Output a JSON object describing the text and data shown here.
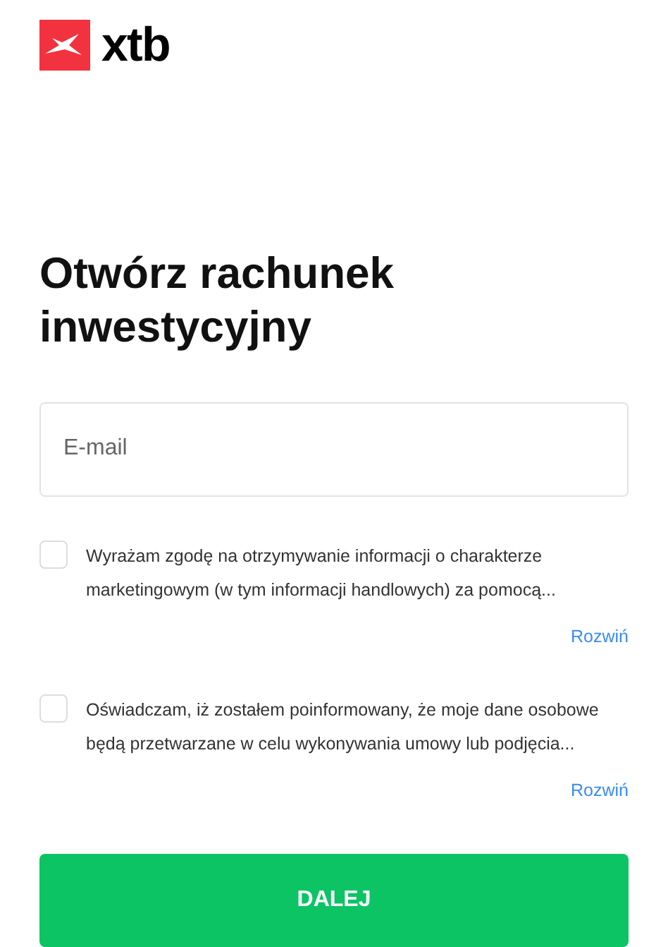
{
  "logo": {
    "text": "xtb"
  },
  "heading": "Otwórz rachunek inwestycyjny",
  "email": {
    "placeholder": "E-mail"
  },
  "consents": [
    {
      "text": "Wyrażam zgodę na otrzymywanie informacji o charakterze marketingowym (w tym informacji handlowych) za pomocą...",
      "checked": false,
      "expand_link": "Rozwiń"
    },
    {
      "text": "Oświadczam, iż zostałem poinformowany, że moje dane osobowe będą przetwarzane w celu wykonywania umowy lub podjęcia...",
      "checked": false,
      "expand_link": "Rozwiń"
    }
  ],
  "submit": "DALEJ"
}
